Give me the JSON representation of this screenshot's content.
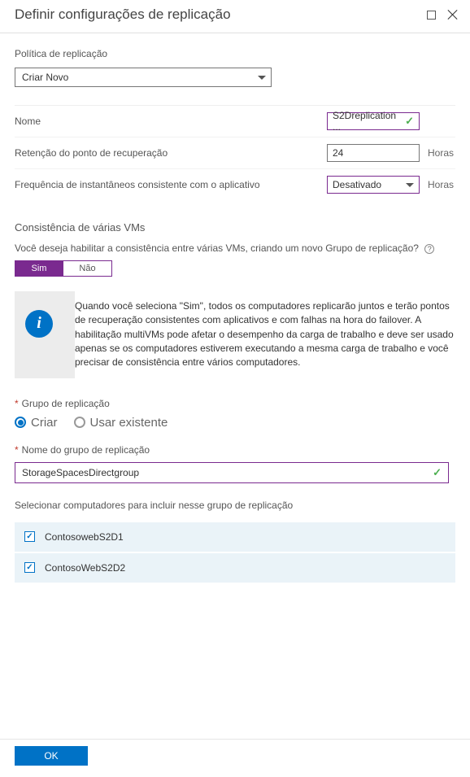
{
  "header": {
    "title": "Definir configurações de replicação"
  },
  "policy": {
    "label": "Política de replicação",
    "selected": "Criar Novo"
  },
  "form": {
    "name_label": "Nome",
    "name_value": "S2Dreplication ...",
    "retention_label": "Retenção do ponto de recuperação",
    "retention_value": "24",
    "retention_unit": "Horas",
    "freq_label": "Frequência de instantâneos consistente com o aplicativo",
    "freq_value": "Desativado",
    "freq_unit": "Horas"
  },
  "multivm": {
    "title": "Consistência de várias VMs",
    "question": "Você deseja habilitar a consistência entre várias VMs, criando um novo Grupo de replicação?",
    "yes": "Sim",
    "no": "Não",
    "info": "Quando você seleciona \"Sim\", todos os computadores replicarão juntos e terão pontos de recuperação consistentes com aplicativos e com falhas na hora do failover. A habilitação multiVMs pode afetar o desempenho da carga de trabalho e deve ser usado apenas se os computadores estiverem executando a mesma carga de trabalho e você precisar de consistência entre vários computadores."
  },
  "group": {
    "label": "Grupo de replicação",
    "radio_create": "Criar",
    "radio_existing": "Usar existente",
    "name_label": "Nome do grupo de replicação",
    "name_value": "StorageSpacesDirectgroup",
    "select_label": "Selecionar computadores para incluir nesse grupo de replicação",
    "computers": [
      "ContosowebS2D1",
      "ContosoWebS2D2"
    ]
  },
  "footer": {
    "ok": "OK"
  }
}
